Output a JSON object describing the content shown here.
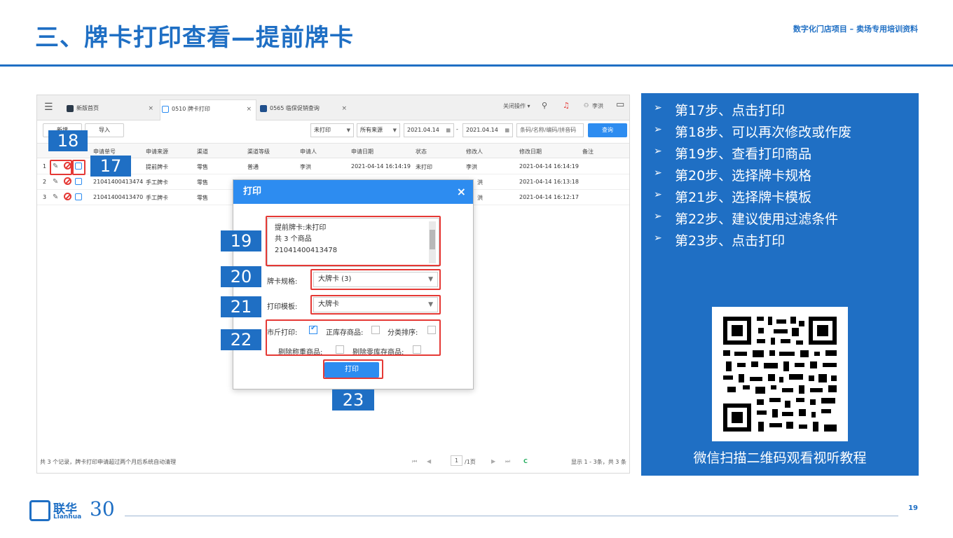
{
  "slide": {
    "title": "三、牌卡打印查看—提前牌卡",
    "subtitle": "数字化门店项目 – 卖场专用培训资料",
    "page_number": "19"
  },
  "app": {
    "tabs": [
      {
        "label": "新版首页",
        "close": "×"
      },
      {
        "label": "0510 牌卡打印",
        "close": "×"
      },
      {
        "label": "0565 临保促销查询",
        "close": "×"
      }
    ],
    "topbar": {
      "shortcut": "关闭操作 ▾",
      "user": "李洪"
    },
    "toolbar": {
      "new_label": "新增",
      "import_label": "导入",
      "status_filter": "未打印",
      "source_filter": "所有来源",
      "date_from": "2021.04.14",
      "date_sep": "-",
      "date_to": "2021.04.14",
      "search_placeholder": "条码/名称/编码/拼音码",
      "query_label": "查询"
    },
    "columns": [
      "申请单号",
      "申请来源",
      "渠道",
      "渠道等级",
      "申请人",
      "申请日期",
      "状态",
      "修改人",
      "修改日期",
      "备注"
    ],
    "rows": [
      {
        "no": "1",
        "id": "",
        "source": "提前牌卡",
        "channel": "零售",
        "level": "普通",
        "applicant": "李洪",
        "date": "2021-04-14 16:14:19",
        "status": "未打印",
        "modifier": "李洪",
        "mdate": "2021-04-14 16:14:19"
      },
      {
        "no": "2",
        "id": "21041400413474",
        "source": "手工牌卡",
        "channel": "零售",
        "level": "",
        "applicant": "",
        "date": "",
        "status": "",
        "modifier": "洪",
        "mdate": "2021-04-14 16:13:18"
      },
      {
        "no": "3",
        "id": "21041400413470",
        "source": "手工牌卡",
        "channel": "零售",
        "level": "",
        "applicant": "",
        "date": "",
        "status": "",
        "modifier": "洪",
        "mdate": "2021-04-14 16:12:17"
      }
    ],
    "footer": {
      "summary": "共 3 个记录，牌卡打印申请超过两个月后系统自动清理",
      "page": "1",
      "page_total": "/1页",
      "display": "显示 1 - 3条，共 3 条"
    }
  },
  "dialog": {
    "title": "打印",
    "close": "×",
    "info_lines": [
      "提前牌卡:未打印",
      "共 3 个商品",
      "21041400413478"
    ],
    "spec_label": "牌卡规格:",
    "spec_value": "大牌卡 (3)",
    "template_label": "打印模板:",
    "template_value": "大牌卡",
    "opt_jin": "市斤打印:",
    "opt_stock": "正库存商品:",
    "opt_sort": "分类排序:",
    "opt_weigh": "剔除称重商品:",
    "opt_zero": "剔除零库存商品:",
    "print_label": "打印"
  },
  "badges": {
    "b17": "17",
    "b18": "18",
    "b19": "19",
    "b20": "20",
    "b21": "21",
    "b22": "22",
    "b23": "23"
  },
  "panel": {
    "steps": [
      "第17步、点击打印",
      "第18步、可以再次修改或作废",
      "第19步、查看打印商品",
      "第20步、选择牌卡规格",
      "第21步、选择牌卡模板",
      "第22步、建议使用过滤条件",
      "第23步、点击打印"
    ],
    "qr_caption": "微信扫描二维码观看视听教程"
  },
  "logo": {
    "cn": "联华",
    "en": "Lianhua",
    "anniv": "30"
  }
}
